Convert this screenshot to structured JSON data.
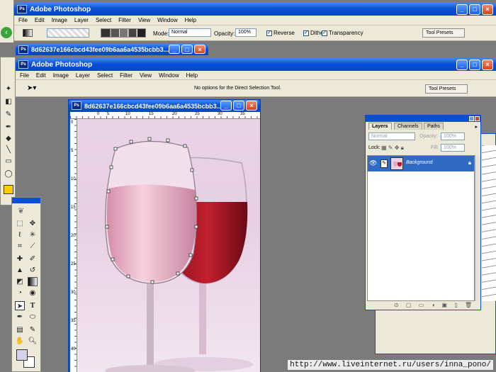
{
  "back_window": {
    "title": "Adobe Photoshop",
    "menu": [
      "File",
      "Edit",
      "Image",
      "Layer",
      "Select",
      "Filter",
      "View",
      "Window",
      "Help"
    ],
    "options": {
      "mode_label": "Mode:",
      "mode_value": "Normal",
      "opacity_label": "Opacity:",
      "opacity_value": "100%",
      "reverse_label": "Reverse",
      "dither_label": "Dither",
      "transparency_label": "Transparency",
      "tool_presets": "Tool Presets"
    },
    "doc_tab_title": "8d62637e166cbcd43fee09b6aa6a4535bcbb3..."
  },
  "front_window": {
    "title": "Adobe Photoshop",
    "menu": [
      "File",
      "Edit",
      "Image",
      "Layer",
      "Select",
      "Filter",
      "View",
      "Window",
      "Help"
    ],
    "options_hint": "No options for the Direct Selection Tool.",
    "tool_presets": "Tool Presets"
  },
  "document": {
    "title": "8d62637e166cbcd43fee09b6aa6a4535bcbb3...",
    "ruler_numbers": [
      "0",
      "5",
      "10",
      "15",
      "20",
      "25",
      "30",
      "35"
    ],
    "ruler_v_numbers": [
      "0",
      "5",
      "10",
      "15",
      "20",
      "25",
      "30",
      "35",
      "40"
    ]
  },
  "layers_panel": {
    "tabs": [
      "Layers",
      "Channels",
      "Paths"
    ],
    "blend_mode": "Normal",
    "opacity_label": "Opacity:",
    "opacity_value": "100%",
    "lock_label": "Lock:",
    "fill_label": "Fill:",
    "fill_value": "100%",
    "layer_name": "Background"
  },
  "watermark_url": "http://www.liveinternet.ru/users/inna_pono/",
  "colors": {
    "xp_blue": "#0a4fd8",
    "chrome": "#ece9d8",
    "workspace": "#7b7b7b",
    "wine_red": "#b51a2a",
    "canvas_pink": "#ead2e6",
    "layer_selected": "#316ac5"
  }
}
